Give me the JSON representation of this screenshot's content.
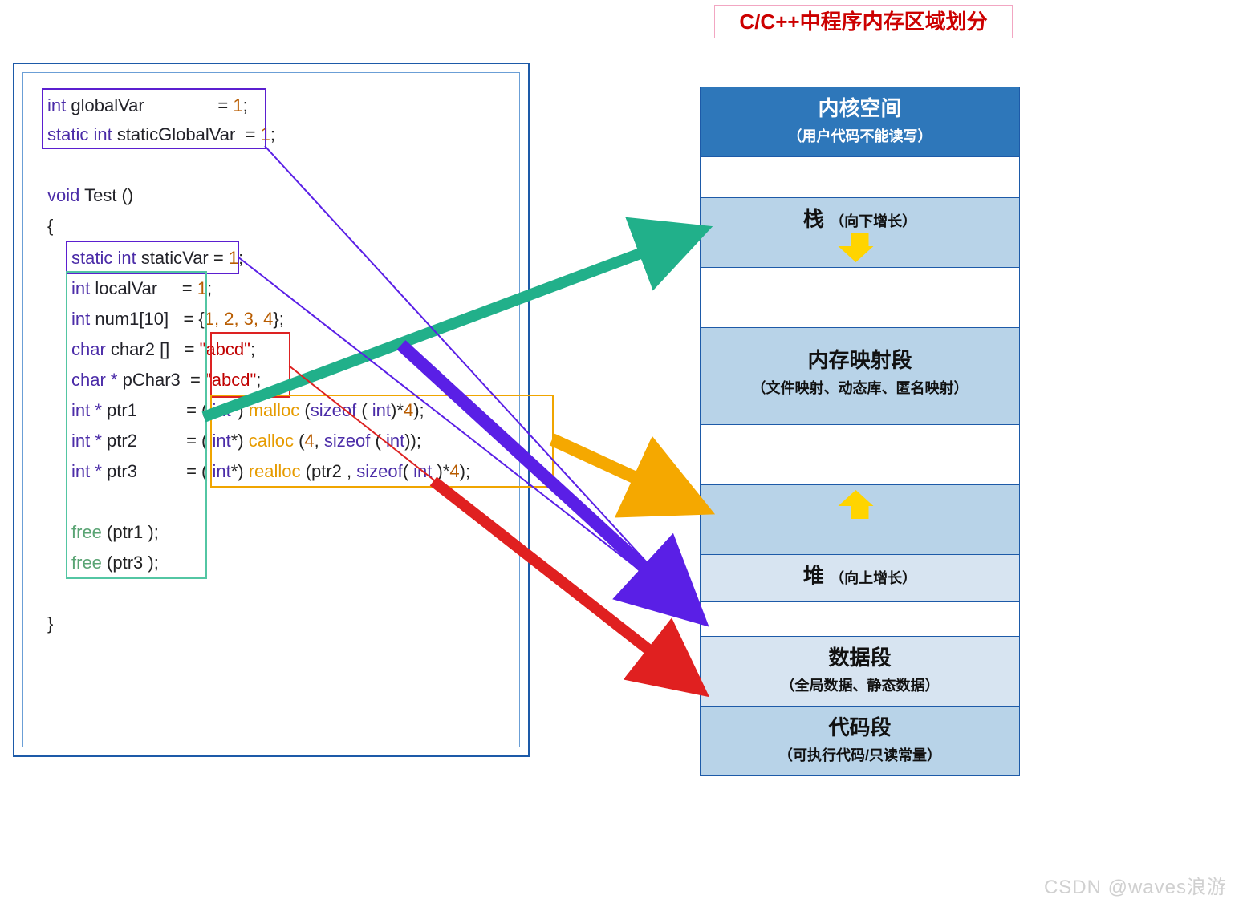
{
  "title": "C/C++中程序内存区域划分",
  "code": {
    "g1_kw": "int ",
    "g1_id": "globalVar ",
    "g1_eq": "= ",
    "g1_lit": "1",
    "g1_end": ";",
    "g2_kw": "static int ",
    "g2_id": "staticGlobalVar ",
    "g2_eq": "= ",
    "g2_lit": "1",
    "g2_end": ";",
    "fn_kw": "void ",
    "fn_id": "Test ",
    "fn_par": "()",
    "lb": "{",
    "sv_kw": "static int ",
    "sv_id": "staticVar ",
    "sv_eq": "= ",
    "sv_lit": "1",
    "sv_end": ";",
    "lv_kw": "int ",
    "lv_id": "localVar     ",
    "lv_eq": "= ",
    "lv_lit": "1",
    "lv_end": ";",
    "n1_kw": "int ",
    "n1_id": "num1[10]   ",
    "n1_eq": "= {",
    "n1_lit": "1, 2, 3, 4",
    "n1_end": "};",
    "c2_kw": "char ",
    "c2_id": "char2 []   ",
    "c2_eq": "= ",
    "c2_str": "\"abcd\"",
    "c2_end": ";",
    "pc_kw": "char * ",
    "pc_id": "pChar3  ",
    "pc_eq": "= ",
    "pc_str": "\"abcd\"",
    "pc_end": ";",
    "p1_kw": "int * ",
    "p1_id": "ptr1          ",
    "p1_eq": "= ( ",
    "p1_cast": "int",
    "p1_eq2": "*) ",
    "p1_fn": "malloc ",
    "p1_arg1": "(",
    "p1_so": "sizeof ",
    "p1_arg2": "( ",
    "p1_ty": "int",
    "p1_arg3": ")*",
    "p1_lit": "4",
    "p1_arg4": ");",
    "p2_kw": "int * ",
    "p2_id": "ptr2          ",
    "p2_eq": "= ( ",
    "p2_cast": "int",
    "p2_eq2": "*) ",
    "p2_fn": "calloc ",
    "p2_arg1": "(",
    "p2_lit": "4",
    "p2_arg2": ", ",
    "p2_so": "sizeof ",
    "p2_arg3": "( ",
    "p2_ty": "int",
    "p2_arg4": "));",
    "p3_kw": "int * ",
    "p3_id": "ptr3          ",
    "p3_eq": "= ( ",
    "p3_cast": "int",
    "p3_eq2": "*) ",
    "p3_fn": "realloc ",
    "p3_arg1": "(ptr2 , ",
    "p3_so": "sizeof",
    "p3_arg2": "( ",
    "p3_ty": "int ",
    "p3_arg3": ")*",
    "p3_lit": "4",
    "p3_arg4": ");",
    "f1_fn": "free ",
    "f1_arg": "(ptr1 );",
    "f3_fn": "free ",
    "f3_arg": "(ptr3 );",
    "rb": "}"
  },
  "mem": {
    "kernel_t": "内核空间",
    "kernel_s": "（用户代码不能读写）",
    "stack_t": "栈",
    "stack_s": "（向下增长）",
    "mmap_t": "内存映射段",
    "mmap_s": "（文件映射、动态库、匿名映射）",
    "heap_t": "堆",
    "heap_s": "（向上增长）",
    "data_t": "数据段",
    "data_s": "（全局数据、静态数据）",
    "code_t": "代码段",
    "code_s": "（可执行代码/只读常量）"
  },
  "watermark": "CSDN @waves浪游",
  "chart_data": {
    "type": "diagram",
    "description": "C/C++ program memory region layout (top = high address → bottom = low address)",
    "segments_top_to_bottom": [
      {
        "name": "内核空间",
        "note": "用户代码不能读写"
      },
      {
        "name": "栈",
        "note": "向下增长"
      },
      {
        "name": "内存映射段",
        "note": "文件映射、动态库、匿名映射"
      },
      {
        "name": "堆",
        "note": "向上增长"
      },
      {
        "name": "数据段",
        "note": "全局数据、静态数据"
      },
      {
        "name": "代码段",
        "note": "可执行代码/只读常量"
      }
    ],
    "mappings": [
      {
        "from": "stack-locals box (localVar,num1,char2,pChar3,ptr1..3,free)",
        "to": "栈",
        "color": "green"
      },
      {
        "from": "heap-allocs box (malloc/calloc/realloc results)",
        "to": "堆",
        "color": "orange"
      },
      {
        "from": "globals box + staticVar box",
        "to": "数据段",
        "color": "purple"
      },
      {
        "from": "string-literal box \"abcd\"",
        "to": "代码段",
        "color": "red"
      }
    ]
  }
}
